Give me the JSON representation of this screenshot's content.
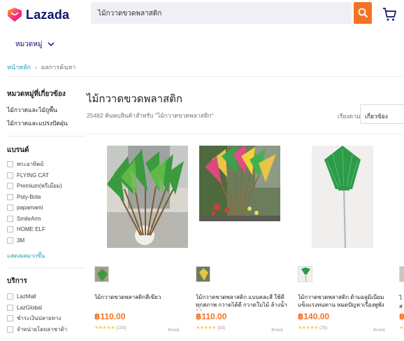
{
  "header": {
    "logo_text": "Lazada",
    "search_value": "ไม้กวาดขวดพลาสติก",
    "icons": {
      "search": "search-icon",
      "cart": "cart-icon"
    },
    "brand_color": "#f57224"
  },
  "category_menu": {
    "label": "หมวดหมู่"
  },
  "breadcrumb": {
    "home": "หน้าหลัก",
    "current": "ผลการค้นหา"
  },
  "sidebar": {
    "related_categories": {
      "title": "หมวดหมู่ที่เกี่ยวข้อง",
      "items": [
        "ไม้กวาดและไม้ถูพื้น",
        "ไม้กวาดและแปรงปัดฝุ่น"
      ]
    },
    "brands": {
      "title": "แบรนด์",
      "items": [
        "พระอาทิตย์",
        "FLYING CAT",
        "Premium(พรีเมี่ยม)",
        "Poly-Brite",
        "papamami",
        "SmileArm",
        "HOME ELF",
        "3M"
      ],
      "more": "แสดงผลมากขึ้น"
    },
    "services": {
      "title": "บริการ",
      "items": [
        "LazMall",
        "LazGlobal",
        "ชำระเงินปลายทาง",
        "จำหน่ายโดยลาซาด้า"
      ]
    }
  },
  "results": {
    "title": "ไม้กวาดขวดพลาสติก",
    "count_text": "25482 ค้นพบสินค้าสำหรับ \"ไม้กวาดขวดพลาสติก\"",
    "sort_label": "เรียงตาม:",
    "sort_value": "เกี่ยวข้อง"
  },
  "products": [
    {
      "title": "ไม้กวาดขวดพลาสติกสีเขียว",
      "price": "฿110.00",
      "stars": "★★★★★",
      "reviews": "(109)",
      "location": "ลักษณ์"
    },
    {
      "title": "ไม้กวาดขวดพลาสติก แบบคละสี ใช้ดีทุกสภาพ กวาดได้ดี กวาดใบไม้ ล้างน้ำได้...",
      "price": "฿110.00",
      "stars": "★★★★★",
      "reviews": "(93)",
      "location": "ลักษณ์"
    },
    {
      "title": "ไม้กวาดขวดพลาสติก ด้ามอลูมิเนียม แข็งแรงทนทาน หมดปัญหาเรื่องพูพัง จาก...",
      "price": "฿140.00",
      "stars": "★★★★★",
      "reviews": "(25)",
      "location": "ลักษณ์"
    }
  ],
  "edge_product": {
    "title": "ไ",
    "title2": "ส",
    "price": "฿"
  }
}
